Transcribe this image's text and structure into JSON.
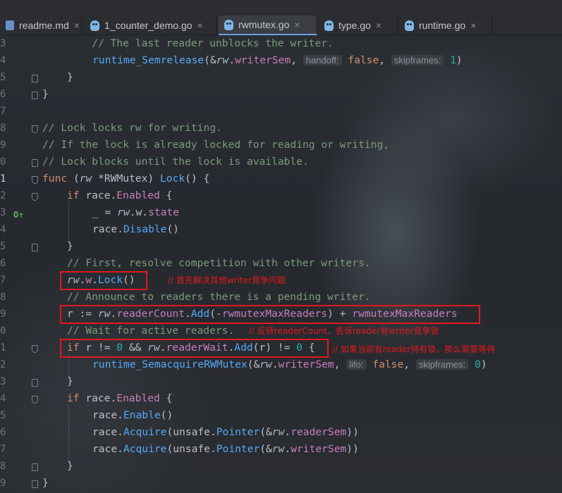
{
  "tabs": [
    {
      "label": "readme.md",
      "close": "×",
      "icon": "markdown-file-icon"
    },
    {
      "label": "1_counter_demo.go",
      "close": "×",
      "icon": "gopher-file-icon"
    },
    {
      "label": "rwmutex.go",
      "close": "×",
      "icon": "gopher-file-icon",
      "active": true
    },
    {
      "label": "type.go",
      "close": "×",
      "icon": "gopher-file-icon"
    },
    {
      "label": "runtime.go",
      "close": "×",
      "icon": "gopher-file-icon"
    }
  ],
  "line_numbers": [
    "3",
    "4",
    "5",
    "6",
    "7",
    "8",
    "9",
    "0",
    "1",
    "2",
    "3",
    "4",
    "5",
    "6",
    "7",
    "8",
    "9",
    "0",
    "1",
    "2",
    "3",
    "4",
    "5",
    "6",
    "7",
    "8",
    "9"
  ],
  "code": {
    "l1": {
      "a": "        // The last reader unblocks the writer."
    },
    "l2": {
      "a": "runtime_Semrelease",
      "b": "(&",
      "c": "rw",
      "d": ".",
      "e": "writerSem",
      "f": ", ",
      "g": "handoff:",
      "h": "false",
      "i": ", ",
      "j": "skipframes:",
      "k": "1",
      "l": ")"
    },
    "l3": {
      "a": "}"
    },
    "l4": {
      "a": "}"
    },
    "l6": {
      "a": "// Lock locks rw for writing."
    },
    "l7": {
      "a": "// If the lock is already locked for reading or writing,"
    },
    "l8": {
      "a": "// Lock blocks until the lock is available."
    },
    "l9": {
      "a": "func",
      "b": " (",
      "c": "rw",
      "d": " *RWMutex) ",
      "e": "Lock",
      "f": "() {"
    },
    "l10": {
      "a": "if",
      "b": " race.",
      "c": "Enabled",
      "d": " {"
    },
    "l11": {
      "a": "_ = ",
      "b": "rw",
      "c": ".w.",
      "d": "state"
    },
    "l12": {
      "a": "race.",
      "b": "Disable",
      "c": "()"
    },
    "l13": {
      "a": "}"
    },
    "l14": {
      "a": "// First, resolve competition with other writers."
    },
    "l15": {
      "a": "rw",
      "b": ".",
      "c": "w",
      "d": ".",
      "e": "Lock",
      "f": "()"
    },
    "l16": {
      "a": "// Announce to readers there is a pending writer."
    },
    "l17": {
      "a": "r",
      "b": " := ",
      "c": "rw",
      "d": ".",
      "e": "readerCount",
      "f": ".",
      "g": "Add",
      "h": "(-",
      "i": "rwmutexMaxReaders",
      "j": ") + ",
      "k": "rwmutexMaxReaders"
    },
    "l18": {
      "a": "// Wait for active readers."
    },
    "l19": {
      "a": "if",
      "b": " r != ",
      "c": "0",
      "d": " && ",
      "e": "rw",
      "f": ".",
      "g": "readerWait",
      "h": ".",
      "i": "Add",
      "j": "(r) != ",
      "k": "0",
      "l": " {"
    },
    "l20": {
      "a": "runtime_SemacquireRWMutex",
      "b": "(&",
      "c": "rw",
      "d": ".",
      "e": "writerSem",
      "f": ", ",
      "g": "lifo:",
      "h": "false",
      "i": ", ",
      "j": "skipframes:",
      "k": "0",
      "l": ")"
    },
    "l21": {
      "a": "}"
    },
    "l22": {
      "a": "if",
      "b": " race.",
      "c": "Enabled",
      "d": " {"
    },
    "l23": {
      "a": "race.",
      "b": "Enable",
      "c": "()"
    },
    "l24": {
      "a": "race.",
      "b": "Acquire",
      "c": "(unsafe.",
      "d": "Pointer",
      "e": "(&",
      "f": "rw",
      "g": ".",
      "h": "readerSem",
      "i": "))"
    },
    "l25": {
      "a": "race.",
      "b": "Acquire",
      "c": "(unsafe.",
      "d": "Pointer",
      "e": "(&",
      "f": "rw",
      "g": ".",
      "h": "writerSem",
      "i": "))"
    },
    "l26": {
      "a": "}"
    },
    "l27": {
      "a": "}"
    }
  },
  "annotations": {
    "note1": "// 首先解决其他writer竞争问题",
    "note2": "// 反转readerCount，告诉reader有writer竞争锁",
    "note3": "// 如果当前有reader持有锁，那么需要等待"
  },
  "colors": {
    "keyword": "#cf8e6d",
    "function": "#56a8f5",
    "field": "#c77dbb",
    "comment": "#7a9a7a",
    "number": "#2aacb8",
    "annotation": "#e0191e"
  }
}
